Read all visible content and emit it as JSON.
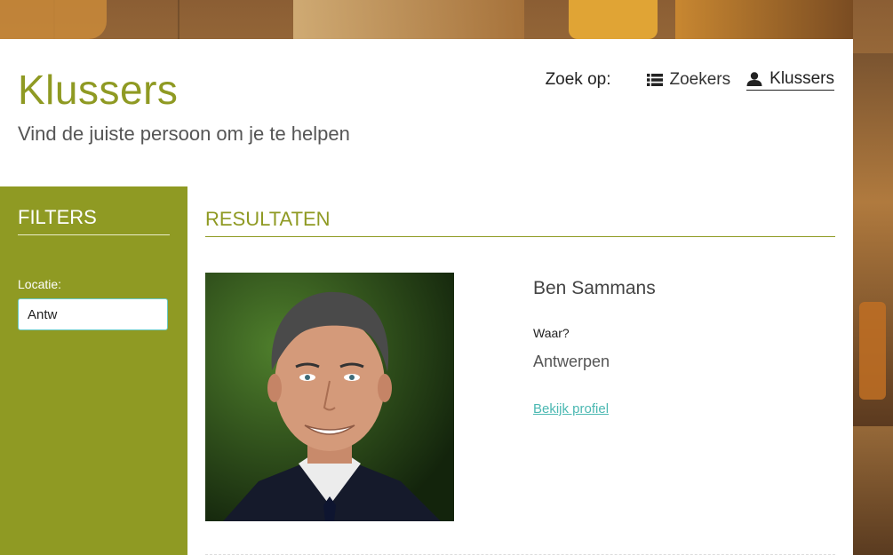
{
  "header": {
    "title": "Klussers",
    "subtitle": "Vind de juiste persoon om je te helpen"
  },
  "search_nav": {
    "label": "Zoek op:",
    "links": [
      {
        "label": "Zoekers",
        "icon": "list-icon",
        "active": false
      },
      {
        "label": "Klussers",
        "icon": "person-icon",
        "active": true
      }
    ]
  },
  "filters": {
    "title": "FILTERS",
    "location_label": "Locatie:",
    "location_value": "Antw"
  },
  "results": {
    "title": "RESULTATEN",
    "items": [
      {
        "name": "Ben Sammans",
        "waar_label": "Waar?",
        "waar_value": "Antwerpen",
        "link_label": "Bekijk profiel"
      }
    ]
  },
  "colors": {
    "accent": "#8f9a23",
    "link": "#4bb8b2",
    "input_border": "#69c8c4"
  }
}
